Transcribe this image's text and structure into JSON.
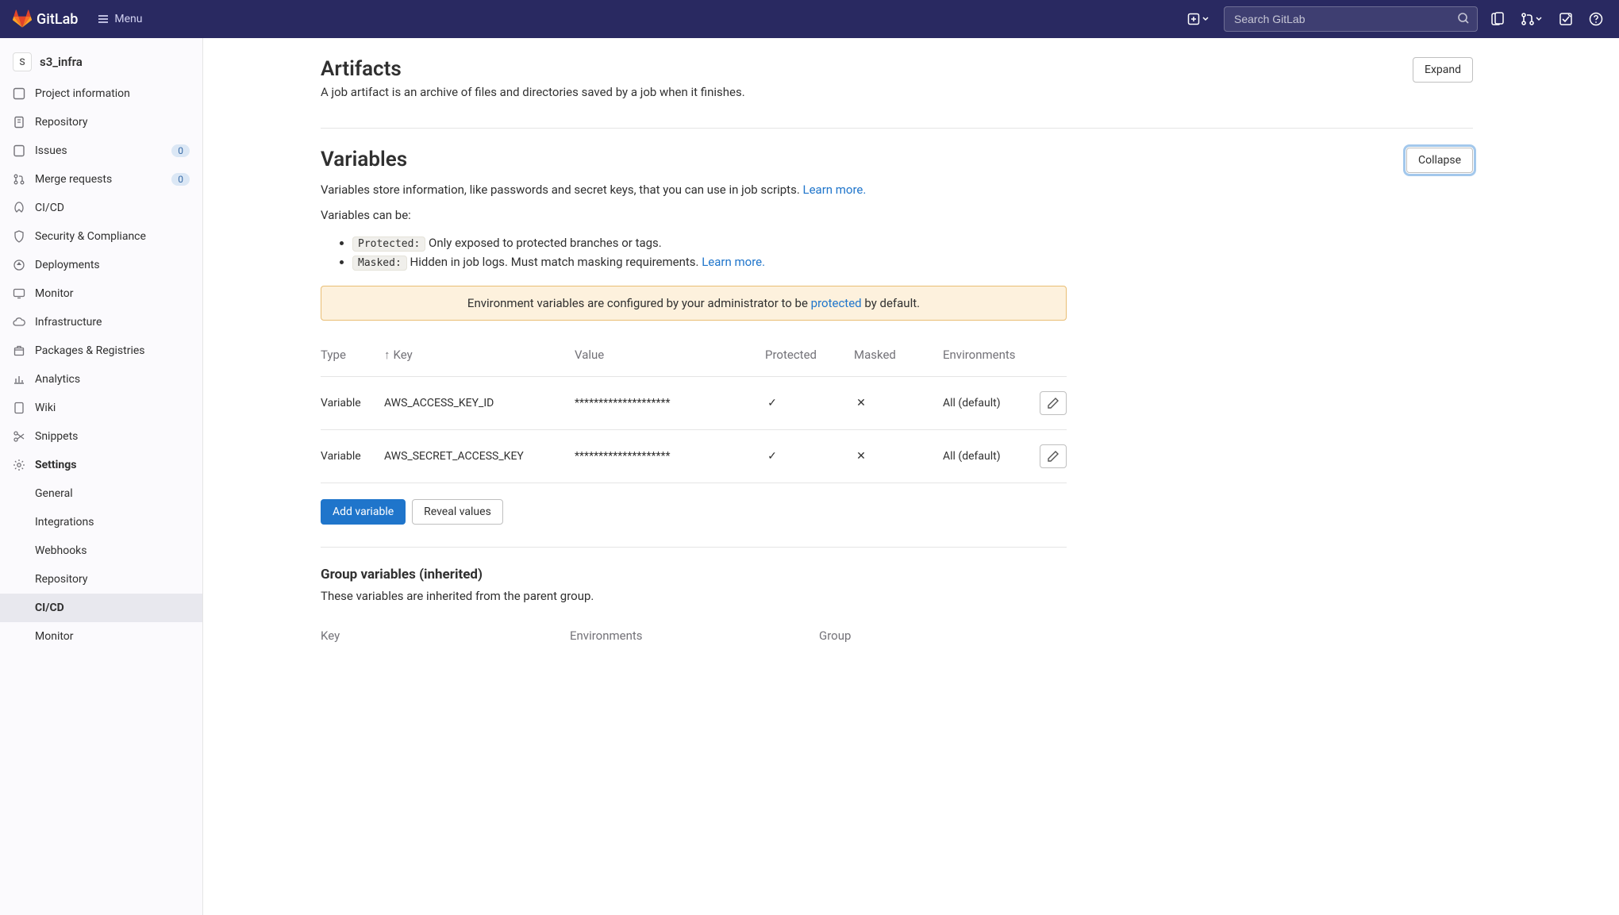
{
  "topnav": {
    "brand": "GitLab",
    "menu": "Menu",
    "search_placeholder": "Search GitLab"
  },
  "sidebar": {
    "avatar_letter": "S",
    "project_name": "s3_infra",
    "items": [
      {
        "label": "Project information"
      },
      {
        "label": "Repository"
      },
      {
        "label": "Issues",
        "badge": "0"
      },
      {
        "label": "Merge requests",
        "badge": "0"
      },
      {
        "label": "CI/CD"
      },
      {
        "label": "Security & Compliance"
      },
      {
        "label": "Deployments"
      },
      {
        "label": "Monitor"
      },
      {
        "label": "Infrastructure"
      },
      {
        "label": "Packages & Registries"
      },
      {
        "label": "Analytics"
      },
      {
        "label": "Wiki"
      },
      {
        "label": "Snippets"
      },
      {
        "label": "Settings"
      }
    ],
    "settings_sub": [
      {
        "label": "General"
      },
      {
        "label": "Integrations"
      },
      {
        "label": "Webhooks"
      },
      {
        "label": "Repository"
      },
      {
        "label": "CI/CD"
      },
      {
        "label": "Monitor"
      }
    ]
  },
  "artifacts": {
    "title": "Artifacts",
    "desc": "A job artifact is an archive of files and directories saved by a job when it finishes.",
    "expand": "Expand"
  },
  "variables": {
    "title": "Variables",
    "collapse": "Collapse",
    "desc_pre": "Variables store information, like passwords and secret keys, that you can use in job scripts. ",
    "learn_more": "Learn more.",
    "can_be": "Variables can be:",
    "protected_code": "Protected:",
    "protected_desc": " Only exposed to protected branches or tags.",
    "masked_code": "Masked:",
    "masked_desc": " Hidden in job logs. Must match masking requirements. ",
    "banner_pre": "Environment variables are configured by your administrator to be ",
    "banner_link": "protected",
    "banner_post": " by default.",
    "columns": {
      "type": "Type",
      "key": "Key",
      "value": "Value",
      "protected": "Protected",
      "masked": "Masked",
      "env": "Environments"
    },
    "rows": [
      {
        "type": "Variable",
        "key": "AWS_ACCESS_KEY_ID",
        "value": "********************",
        "protected": true,
        "masked": false,
        "env": "All (default)"
      },
      {
        "type": "Variable",
        "key": "AWS_SECRET_ACCESS_KEY",
        "value": "********************",
        "protected": true,
        "masked": false,
        "env": "All (default)"
      }
    ],
    "add_btn": "Add variable",
    "reveal_btn": "Reveal values"
  },
  "group_vars": {
    "title": "Group variables (inherited)",
    "desc": "These variables are inherited from the parent group.",
    "columns": {
      "key": "Key",
      "env": "Environments",
      "group": "Group"
    }
  }
}
